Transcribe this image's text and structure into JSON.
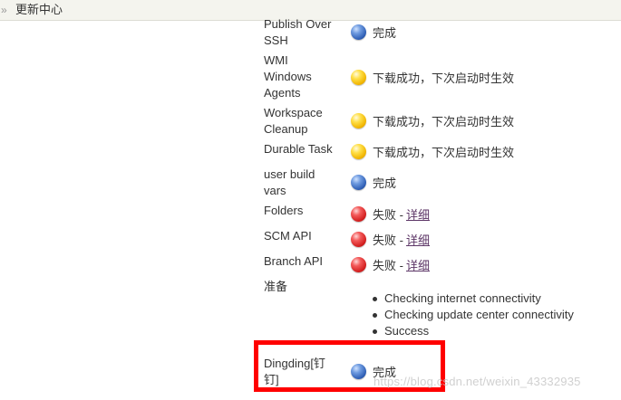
{
  "breadcrumb": {
    "separator": "»",
    "current": "更新中心"
  },
  "plugins": [
    {
      "name": "Publish Over SSH",
      "status": "blue",
      "text": "完成",
      "link": ""
    },
    {
      "name": "WMI Windows Agents",
      "status": "yellow",
      "text": "下载成功，下次启动时生效",
      "link": ""
    },
    {
      "name": "Workspace Cleanup",
      "status": "yellow",
      "text": "下载成功，下次启动时生效",
      "link": ""
    },
    {
      "name": "Durable Task",
      "status": "yellow",
      "text": "下载成功，下次启动时生效",
      "link": ""
    },
    {
      "name": "user build vars",
      "status": "blue",
      "text": "完成",
      "link": ""
    },
    {
      "name": "Folders",
      "status": "red",
      "text": "失败 -",
      "link": "详细"
    },
    {
      "name": "SCM API",
      "status": "red",
      "text": "失败 -",
      "link": "详细"
    },
    {
      "name": "Branch API",
      "status": "red",
      "text": "失败 -",
      "link": "详细"
    }
  ],
  "prepare": {
    "name": "准备",
    "items": [
      "Checking internet connectivity",
      "Checking update center connectivity",
      "Success"
    ]
  },
  "dingding": {
    "name": "Dingding[钉钉]",
    "status": "blue",
    "text": "完成"
  },
  "watermark": "https://blog.csdn.net/weixin_43332935",
  "colors": {
    "highlight": "#ff0000",
    "link": "#5c3566",
    "topbar": "#f4f4ee"
  }
}
